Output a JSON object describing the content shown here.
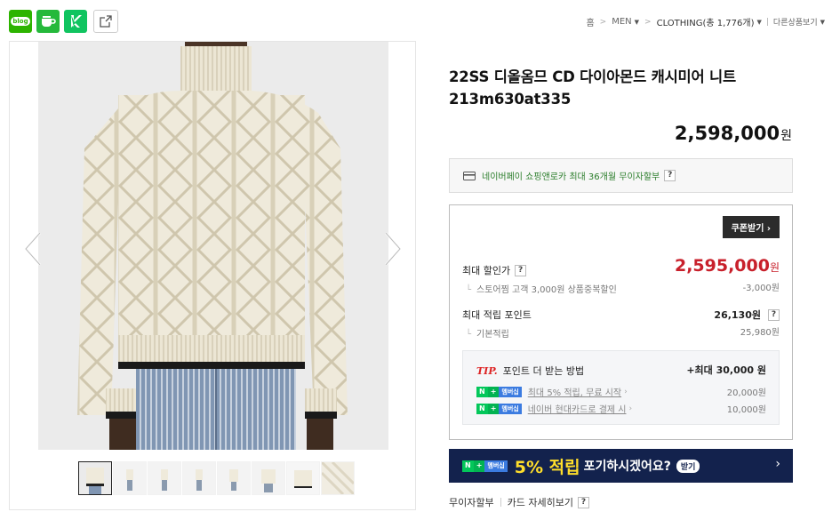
{
  "share": {
    "blog_label": "blog",
    "items": [
      "blog-icon",
      "cafe-icon",
      "k-icon",
      "share-out-icon"
    ]
  },
  "breadcrumb": {
    "home": "홈",
    "men": "MEN",
    "clothing": "CLOTHING(총 1,776개)",
    "other": "다른상품보기"
  },
  "product": {
    "title": "22SS 디올옴므 CD 다이아몬드 캐시미어 니트 213m630at335",
    "price": "2,598,000",
    "currency": "원"
  },
  "npay": {
    "text": "네이버페이 쇼핑앤로카 최대 36개월 무이자할부",
    "help": "?"
  },
  "benefits": {
    "coupon_button": "쿠폰받기 ›",
    "max_discount_label": "최대 할인가",
    "max_discount_value": "2,595,000",
    "won": "원",
    "store_discount_text": "스토어찜 고객 3,000원 상품중복할인",
    "store_discount_value": "-3,000원",
    "points_label": "최대 적립 포인트",
    "points_value": "26,130원",
    "base_points_label": "기본적립",
    "base_points_value": "25,980원",
    "help": "?"
  },
  "tip": {
    "tip_label": "TIP.",
    "title": "포인트 더 받는 방법",
    "max": "+최대 30,000 원",
    "badge_n": "N",
    "badge_plus": "+",
    "badge_membership": "멤버십",
    "lines": [
      {
        "text": "최대 5% 적립, 무료 시작",
        "amount": "20,000원"
      },
      {
        "text": "네이버 현대카드로 결제 시",
        "amount": "10,000원"
      }
    ]
  },
  "banner": {
    "percent": "5% 적립",
    "rest": "포기하시겠어요?",
    "get": "받기",
    "go": "›"
  },
  "bottom": {
    "installment": "무이자할부",
    "card_detail": "카드 자세히보기",
    "help": "?"
  },
  "colors": {
    "price_red": "#c8202b",
    "npay_green": "#2a7d2a",
    "banner_navy": "#13224d",
    "banner_yellow": "#ffde2b",
    "naver_green": "#03c75a"
  }
}
